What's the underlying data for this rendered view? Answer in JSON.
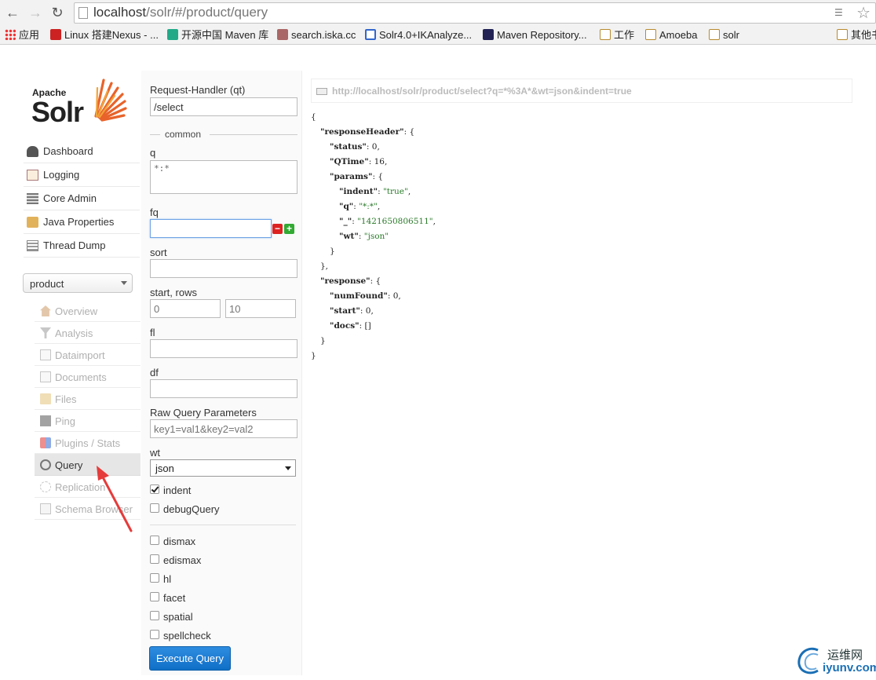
{
  "browser": {
    "url_host": "localhost",
    "url_path": "/solr/#/product/query",
    "bookmarks": [
      {
        "label": "应用",
        "icon": "apps-grid-icon"
      },
      {
        "label": "Linux 搭建Nexus - ...",
        "icon": "red-logo-icon"
      },
      {
        "label": "开源中国 Maven 库",
        "icon": "oschina-icon"
      },
      {
        "label": "search.iska.cc",
        "icon": "solr-favicon-icon"
      },
      {
        "label": "Solr4.0+IKAnalyze...",
        "icon": "google-c-icon"
      },
      {
        "label": "Maven Repository...",
        "icon": "mvn-icon"
      },
      {
        "label": "工作",
        "icon": "folder-icon"
      },
      {
        "label": "Amoeba",
        "icon": "folder-icon"
      },
      {
        "label": "solr",
        "icon": "folder-icon"
      },
      {
        "label": "其他书签",
        "icon": "folder-icon"
      }
    ]
  },
  "logo": {
    "apache": "Apache",
    "solr": "Solr"
  },
  "menu": [
    {
      "label": "Dashboard"
    },
    {
      "label": "Logging"
    },
    {
      "label": "Core Admin"
    },
    {
      "label": "Java Properties"
    },
    {
      "label": "Thread Dump"
    }
  ],
  "core_selector": {
    "value": "product"
  },
  "core_menu": [
    {
      "label": "Overview"
    },
    {
      "label": "Analysis"
    },
    {
      "label": "Dataimport"
    },
    {
      "label": "Documents"
    },
    {
      "label": "Files"
    },
    {
      "label": "Ping"
    },
    {
      "label": "Plugins / Stats"
    },
    {
      "label": "Query",
      "active": true
    },
    {
      "label": "Replication"
    },
    {
      "label": "Schema Browser"
    }
  ],
  "form": {
    "qt_label": "Request-Handler (qt)",
    "qt_value": "/select",
    "common_label": "common",
    "q_label": "q",
    "q_value": "*:*",
    "fq_label": "fq",
    "fq_value": "",
    "sort_label": "sort",
    "sort_value": "",
    "start_rows_label": "start, rows",
    "start_placeholder": "0",
    "rows_placeholder": "10",
    "fl_label": "fl",
    "df_label": "df",
    "raw_label": "Raw Query Parameters",
    "raw_placeholder": "key1=val1&key2=val2",
    "wt_label": "wt",
    "wt_value": "json",
    "indent_label": "indent",
    "indent_checked": true,
    "debug_label": "debugQuery",
    "options": [
      {
        "label": "dismax"
      },
      {
        "label": "edismax"
      },
      {
        "label": "hl"
      },
      {
        "label": "facet"
      },
      {
        "label": "spatial"
      },
      {
        "label": "spellcheck"
      }
    ],
    "execute_label": "Execute Query"
  },
  "response": {
    "request_url": "http://localhost/solr/product/select?q=*%3A*&wt=json&indent=true",
    "lines": [
      {
        "segs": [
          {
            "t": "{",
            "c": "p"
          }
        ]
      },
      {
        "segs": [
          {
            "t": "\"responseHeader\"",
            "c": "k"
          },
          {
            "t": ": {",
            "c": "p"
          }
        ]
      },
      {
        "segs": [
          {
            "t": "\"status\"",
            "c": "k"
          },
          {
            "t": ": ",
            "c": "p"
          },
          {
            "t": "0",
            "c": "nv"
          },
          {
            "t": ",",
            "c": "p"
          }
        ]
      },
      {
        "segs": [
          {
            "t": "\"QTime\"",
            "c": "k"
          },
          {
            "t": ": ",
            "c": "p"
          },
          {
            "t": "16",
            "c": "nv"
          },
          {
            "t": ",",
            "c": "p"
          }
        ]
      },
      {
        "segs": [
          {
            "t": "\"params\"",
            "c": "k"
          },
          {
            "t": ": {",
            "c": "p"
          }
        ]
      },
      {
        "segs": [
          {
            "t": "\"indent\"",
            "c": "k"
          },
          {
            "t": ": ",
            "c": "p"
          },
          {
            "t": "\"true\"",
            "c": "sv"
          },
          {
            "t": ",",
            "c": "p"
          }
        ]
      },
      {
        "segs": [
          {
            "t": "\"q\"",
            "c": "k"
          },
          {
            "t": ": ",
            "c": "p"
          },
          {
            "t": "\"*:*\"",
            "c": "sv"
          },
          {
            "t": ",",
            "c": "p"
          }
        ]
      },
      {
        "segs": [
          {
            "t": "\"_\"",
            "c": "k"
          },
          {
            "t": ": ",
            "c": "p"
          },
          {
            "t": "\"1421650806511\"",
            "c": "sv"
          },
          {
            "t": ",",
            "c": "p"
          }
        ]
      },
      {
        "segs": [
          {
            "t": "\"wt\"",
            "c": "k"
          },
          {
            "t": ": ",
            "c": "p"
          },
          {
            "t": "\"json\"",
            "c": "sv"
          }
        ]
      },
      {
        "segs": [
          {
            "t": "}",
            "c": "p"
          }
        ]
      },
      {
        "segs": [
          {
            "t": "},",
            "c": "p"
          }
        ]
      },
      {
        "segs": [
          {
            "t": "\"response\"",
            "c": "k"
          },
          {
            "t": ": {",
            "c": "p"
          }
        ]
      },
      {
        "segs": [
          {
            "t": "\"numFound\"",
            "c": "k"
          },
          {
            "t": ": ",
            "c": "p"
          },
          {
            "t": "0",
            "c": "nv"
          },
          {
            "t": ",",
            "c": "p"
          }
        ]
      },
      {
        "segs": [
          {
            "t": "\"start\"",
            "c": "k"
          },
          {
            "t": ": ",
            "c": "p"
          },
          {
            "t": "0",
            "c": "nv"
          },
          {
            "t": ",",
            "c": "p"
          }
        ]
      },
      {
        "segs": [
          {
            "t": "\"docs\"",
            "c": "k"
          },
          {
            "t": ": []",
            "c": "p"
          }
        ]
      },
      {
        "segs": [
          {
            "t": "}",
            "c": "p"
          }
        ]
      },
      {
        "segs": [
          {
            "t": "}",
            "c": "p"
          }
        ]
      }
    ]
  },
  "watermark": {
    "cn": "运维网",
    "en": "iyunv.com"
  },
  "colors": {
    "accent": "#1a7fd4",
    "annotation_arrow": "#e63b3b",
    "string_value": "#2a7a2a"
  }
}
